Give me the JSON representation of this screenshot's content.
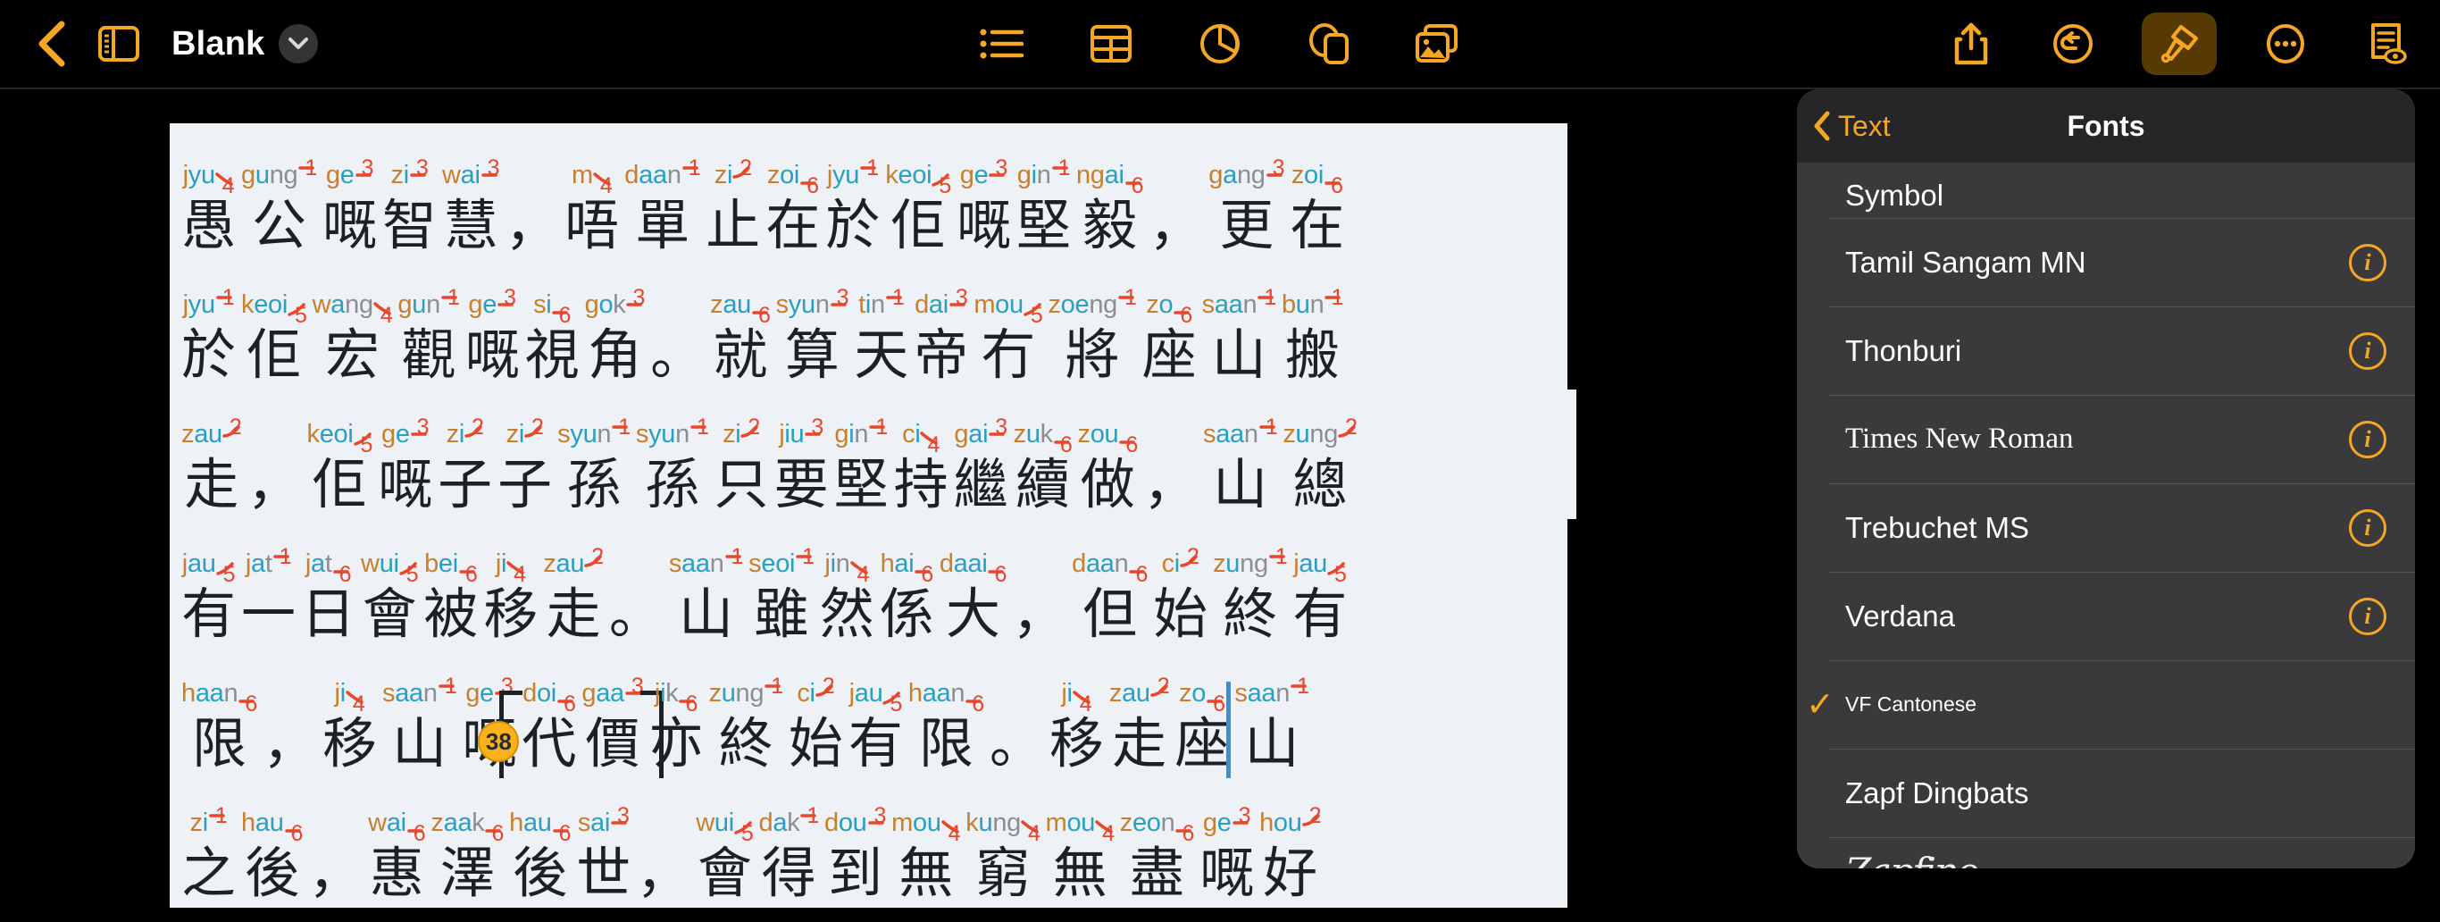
{
  "toolbar": {
    "back_label": "back-chevron",
    "sidebar_label": "sidebar-toggle",
    "doc_title": "Blank",
    "center_items": [
      {
        "name": "list",
        "label": "List"
      },
      {
        "name": "table",
        "label": "Table"
      },
      {
        "name": "chart",
        "label": "Chart"
      },
      {
        "name": "shape",
        "label": "Shape"
      },
      {
        "name": "media",
        "label": "Media"
      }
    ],
    "right_items": [
      {
        "name": "share",
        "label": "Share"
      },
      {
        "name": "undo",
        "label": "Undo"
      },
      {
        "name": "format",
        "label": "Format",
        "active": true
      },
      {
        "name": "more",
        "label": "More"
      },
      {
        "name": "document-options",
        "label": "Document Options"
      }
    ],
    "accent_color": "#f5a623",
    "active_bg": "#573903"
  },
  "panel": {
    "back_label": "Text",
    "title": "Fonts",
    "fonts": [
      {
        "name": "Symbol",
        "style": "normal",
        "info": false,
        "checked": false,
        "partial": "top"
      },
      {
        "name": "Tamil Sangam MN",
        "style": "normal",
        "info": true,
        "checked": false
      },
      {
        "name": "Thonburi",
        "style": "normal",
        "info": true,
        "checked": false
      },
      {
        "name": "Times New Roman",
        "style": "serif",
        "info": true,
        "checked": false
      },
      {
        "name": "Trebuchet MS",
        "style": "normal",
        "info": true,
        "checked": false
      },
      {
        "name": "Verdana",
        "style": "normal",
        "info": true,
        "checked": false
      },
      {
        "name": "VF Cantonese",
        "style": "small",
        "info": false,
        "checked": true
      },
      {
        "name": "Zapf Dingbats",
        "style": "normal",
        "info": false,
        "checked": false
      },
      {
        "name": "Zapfino",
        "style": "script",
        "info": false,
        "checked": false,
        "partial": "bottom"
      }
    ],
    "check_glyph": "✓",
    "info_glyph": "i"
  },
  "document": {
    "badge": "38",
    "lines": [
      {
        "width_class": "w-a",
        "cells": [
          {
            "ruby": "jyu",
            "tone": "4",
            "base": "愚"
          },
          {
            "ruby": "gung",
            "tone": "1",
            "base": "公"
          },
          {
            "ruby": "ge",
            "tone": "3",
            "base": "嘅"
          },
          {
            "ruby": "zi",
            "tone": "3",
            "base": "智"
          },
          {
            "ruby": "wai",
            "tone": "3",
            "base": "慧"
          },
          {
            "ruby": "",
            "tone": "",
            "base": "，",
            "punct": true
          },
          {
            "ruby": "m",
            "tone": "4",
            "base": "唔"
          },
          {
            "ruby": "daan",
            "tone": "1",
            "base": "單"
          },
          {
            "ruby": "zi",
            "tone": "2",
            "base": "止"
          },
          {
            "ruby": "zoi",
            "tone": "6",
            "base": "在"
          },
          {
            "ruby": "jyu",
            "tone": "1",
            "base": "於"
          },
          {
            "ruby": "keoi",
            "tone": "5",
            "base": "佢"
          },
          {
            "ruby": "ge",
            "tone": "3",
            "base": "嘅"
          },
          {
            "ruby": "gin",
            "tone": "1",
            "base": "堅"
          },
          {
            "ruby": "ngai",
            "tone": "6",
            "base": "毅"
          },
          {
            "ruby": "",
            "tone": "",
            "base": "，",
            "punct": true
          },
          {
            "ruby": "gang",
            "tone": "3",
            "base": "更"
          },
          {
            "ruby": "zoi",
            "tone": "6",
            "base": "在"
          }
        ]
      },
      {
        "width_class": "w-b",
        "cells": [
          {
            "ruby": "jyu",
            "tone": "1",
            "base": "於"
          },
          {
            "ruby": "keoi",
            "tone": "5",
            "base": "佢"
          },
          {
            "ruby": "wang",
            "tone": "4",
            "base": "宏"
          },
          {
            "ruby": "gun",
            "tone": "1",
            "base": "觀"
          },
          {
            "ruby": "ge",
            "tone": "3",
            "base": "嘅"
          },
          {
            "ruby": "si",
            "tone": "6",
            "base": "視"
          },
          {
            "ruby": "gok",
            "tone": "3",
            "base": "角"
          },
          {
            "ruby": "",
            "tone": "",
            "base": "。",
            "punct": true
          },
          {
            "ruby": "zau",
            "tone": "6",
            "base": "就"
          },
          {
            "ruby": "syun",
            "tone": "3",
            "base": "算"
          },
          {
            "ruby": "tin",
            "tone": "1",
            "base": "天"
          },
          {
            "ruby": "dai",
            "tone": "3",
            "base": "帝"
          },
          {
            "ruby": "mou",
            "tone": "5",
            "base": "冇"
          },
          {
            "ruby": "zoeng",
            "tone": "1",
            "base": "將"
          },
          {
            "ruby": "zo",
            "tone": "6",
            "base": "座"
          },
          {
            "ruby": "saan",
            "tone": "1",
            "base": "山"
          },
          {
            "ruby": "bun",
            "tone": "1",
            "base": "搬"
          }
        ]
      },
      {
        "width_class": "w-c",
        "cells": [
          {
            "ruby": "zau",
            "tone": "2",
            "base": "走"
          },
          {
            "ruby": "",
            "tone": "",
            "base": "，",
            "punct": true
          },
          {
            "ruby": "keoi",
            "tone": "5",
            "base": "佢"
          },
          {
            "ruby": "ge",
            "tone": "3",
            "base": "嘅"
          },
          {
            "ruby": "zi",
            "tone": "2",
            "base": "子"
          },
          {
            "ruby": "zi",
            "tone": "2",
            "base": "子"
          },
          {
            "ruby": "syun",
            "tone": "1",
            "base": "孫"
          },
          {
            "ruby": "syun",
            "tone": "1",
            "base": "孫"
          },
          {
            "ruby": "zi",
            "tone": "2",
            "base": "只"
          },
          {
            "ruby": "jiu",
            "tone": "3",
            "base": "要"
          },
          {
            "ruby": "gin",
            "tone": "1",
            "base": "堅"
          },
          {
            "ruby": "ci",
            "tone": "4",
            "base": "持"
          },
          {
            "ruby": "gai",
            "tone": "3",
            "base": "繼"
          },
          {
            "ruby": "zuk",
            "tone": "6",
            "base": "續"
          },
          {
            "ruby": "zou",
            "tone": "6",
            "base": "做"
          },
          {
            "ruby": "",
            "tone": "",
            "base": "，",
            "punct": true
          },
          {
            "ruby": "saan",
            "tone": "1",
            "base": "山"
          },
          {
            "ruby": "zung",
            "tone": "2",
            "base": "總"
          }
        ]
      },
      {
        "width_class": "w-d",
        "cells": [
          {
            "ruby": "jau",
            "tone": "5",
            "base": "有"
          },
          {
            "ruby": "jat",
            "tone": "1",
            "base": "一"
          },
          {
            "ruby": "jat",
            "tone": "6",
            "base": "日"
          },
          {
            "ruby": "wui",
            "tone": "5",
            "base": "會"
          },
          {
            "ruby": "bei",
            "tone": "6",
            "base": "被"
          },
          {
            "ruby": "ji",
            "tone": "4",
            "base": "移"
          },
          {
            "ruby": "zau",
            "tone": "2",
            "base": "走"
          },
          {
            "ruby": "",
            "tone": "",
            "base": "。",
            "punct": true
          },
          {
            "ruby": "saan",
            "tone": "1",
            "base": "山"
          },
          {
            "ruby": "seoi",
            "tone": "1",
            "base": "雖"
          },
          {
            "ruby": "jin",
            "tone": "4",
            "base": "然"
          },
          {
            "ruby": "hai",
            "tone": "6",
            "base": "係"
          },
          {
            "ruby": "daai",
            "tone": "6",
            "base": "大"
          },
          {
            "ruby": "",
            "tone": "",
            "base": "，",
            "punct": true
          },
          {
            "ruby": "daan",
            "tone": "6",
            "base": "但"
          },
          {
            "ruby": "ci",
            "tone": "2",
            "base": "始"
          },
          {
            "ruby": "zung",
            "tone": "1",
            "base": "終"
          },
          {
            "ruby": "jau",
            "tone": "5",
            "base": "有"
          }
        ]
      },
      {
        "width_class": "w-e",
        "cells": [
          {
            "ruby": "haan",
            "tone": "6",
            "base": "限"
          },
          {
            "ruby": "",
            "tone": "",
            "base": "，",
            "punct": true
          },
          {
            "ruby": "ji",
            "tone": "4",
            "base": "移"
          },
          {
            "ruby": "saan",
            "tone": "1",
            "base": "山"
          },
          {
            "ruby": "ge",
            "tone": "3",
            "base": "嘅"
          },
          {
            "ruby": "doi",
            "tone": "6",
            "base": "代",
            "bracket": "open"
          },
          {
            "ruby": "gaa",
            "tone": "3",
            "base": "價",
            "bracket": "close"
          },
          {
            "ruby": "jik",
            "tone": "6",
            "base": "亦"
          },
          {
            "ruby": "zung",
            "tone": "1",
            "base": "終"
          },
          {
            "ruby": "ci",
            "tone": "2",
            "base": "始"
          },
          {
            "ruby": "jau",
            "tone": "5",
            "base": "有"
          },
          {
            "ruby": "haan",
            "tone": "6",
            "base": "限"
          },
          {
            "ruby": "",
            "tone": "",
            "base": "。",
            "punct": true
          },
          {
            "ruby": "ji",
            "tone": "4",
            "base": "移"
          },
          {
            "ruby": "zau",
            "tone": "2",
            "base": "走"
          },
          {
            "ruby": "zo",
            "tone": "6",
            "base": "座"
          },
          {
            "ruby": "saan",
            "tone": "1",
            "base": "山",
            "caret": true
          }
        ]
      },
      {
        "width_class": "w-f",
        "cells": [
          {
            "ruby": "zi",
            "tone": "1",
            "base": "之"
          },
          {
            "ruby": "hau",
            "tone": "6",
            "base": "後"
          },
          {
            "ruby": "",
            "tone": "",
            "base": "，",
            "punct": true
          },
          {
            "ruby": "wai",
            "tone": "6",
            "base": "惠"
          },
          {
            "ruby": "zaak",
            "tone": "6",
            "base": "澤"
          },
          {
            "ruby": "hau",
            "tone": "6",
            "base": "後"
          },
          {
            "ruby": "sai",
            "tone": "3",
            "base": "世"
          },
          {
            "ruby": "",
            "tone": "",
            "base": "，",
            "punct": true
          },
          {
            "ruby": "wui",
            "tone": "5",
            "base": "會"
          },
          {
            "ruby": "dak",
            "tone": "1",
            "base": "得"
          },
          {
            "ruby": "dou",
            "tone": "3",
            "base": "到"
          },
          {
            "ruby": "mou",
            "tone": "4",
            "base": "無"
          },
          {
            "ruby": "kung",
            "tone": "4",
            "base": "窮"
          },
          {
            "ruby": "mou",
            "tone": "4",
            "base": "無"
          },
          {
            "ruby": "zeon",
            "tone": "6",
            "base": "盡"
          },
          {
            "ruby": "ge",
            "tone": "3",
            "base": "嘅"
          },
          {
            "ruby": "hou",
            "tone": "2",
            "base": "好"
          }
        ]
      }
    ]
  }
}
